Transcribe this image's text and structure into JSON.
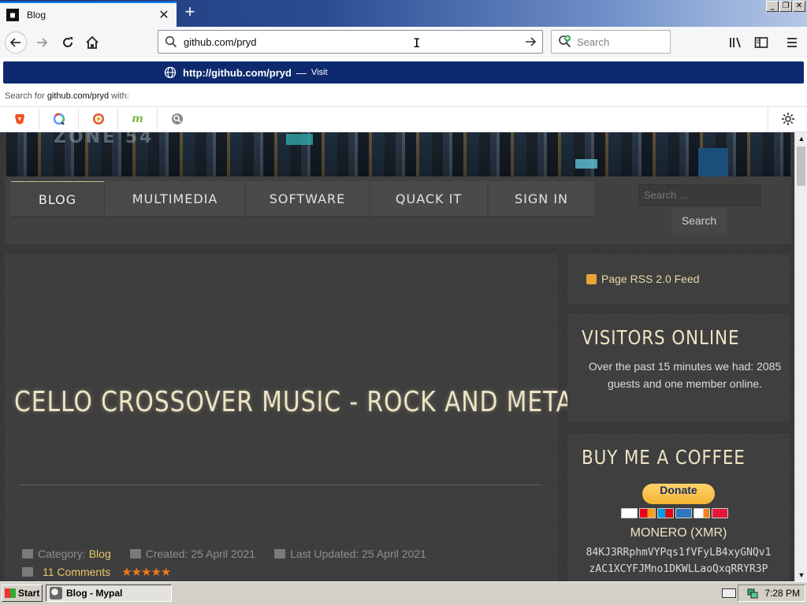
{
  "browser": {
    "tab": {
      "title": "Blog",
      "favicon_text": "■"
    },
    "url": "github.com/pryd",
    "search_placeholder": "Search",
    "suggestion": {
      "url": "http://github.com/pryd",
      "separator": "—",
      "action": "Visit"
    },
    "search_for_prefix": "Search for",
    "search_for_term": "github.com/pryd",
    "search_for_suffix": "with:",
    "engines": [
      "brave-icon",
      "qwant-icon",
      "duckduckgo-icon",
      "mojeek-icon",
      "search-engine-icon"
    ]
  },
  "site": {
    "menu": [
      {
        "label": "BLOG",
        "active": true
      },
      {
        "label": "MULTIMEDIA"
      },
      {
        "label": "SOFTWARE"
      },
      {
        "label": "QUACK IT"
      },
      {
        "label": "SIGN IN"
      }
    ],
    "search_placeholder": "Search ...",
    "search_button": "Search",
    "article": {
      "title": "CELLO CROSSOVER MUSIC - ROCK AND METAL",
      "category_label": "Category:",
      "category": "Blog",
      "created": "Created: 25 April 2021",
      "updated": "Last Updated: 25 April 2021",
      "comments": "11 Comments",
      "stars": "★★★★★"
    },
    "sidebar": {
      "rss": "Page RSS 2.0 Feed",
      "visitors_title": "VISITORS ONLINE",
      "visitors_text": "Over the past 15 minutes we had: 2085 guests and one member online.",
      "coffee_title": "BUY ME A COFFEE",
      "donate": "Donate",
      "monero": "MONERO (XMR)",
      "xmr_line1": "84KJ3RRphmVYPqs1fVFyLB4xyGNQv1",
      "xmr_line2": "zAC1XCYFJMno1DKWLLaoQxqRRYR3P"
    }
  },
  "taskbar": {
    "start": "Start",
    "task": "Blog - Mypal",
    "clock": "7:28 PM"
  },
  "colors": {
    "url_suggestion_bg": "#0e2a6e",
    "site_gold": "#e8c66a",
    "site_heading": "#ece4c4"
  }
}
